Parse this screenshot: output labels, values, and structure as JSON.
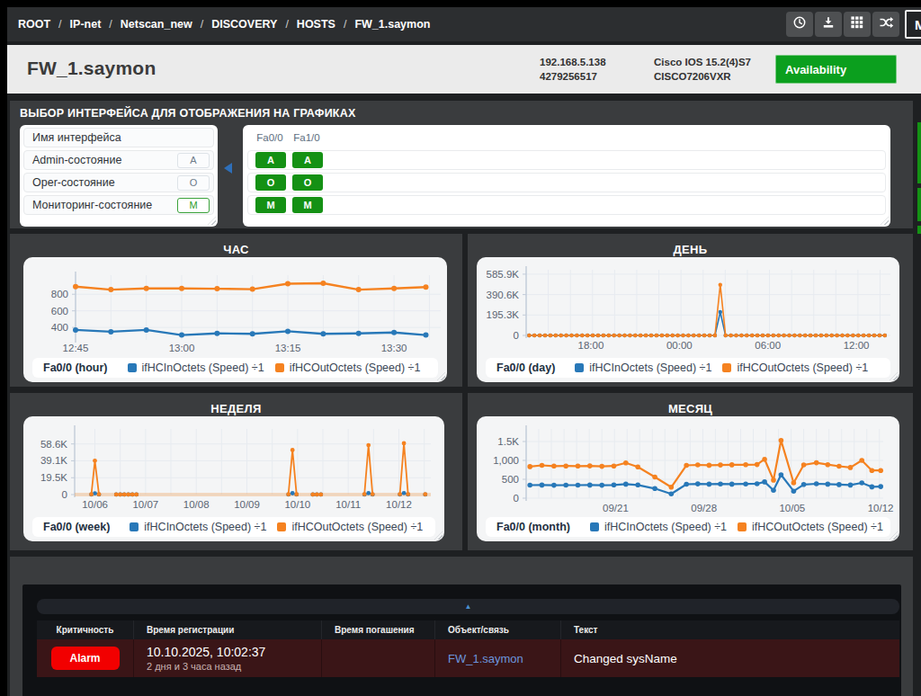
{
  "nav": {
    "breadcrumbs": [
      "ROOT",
      "IP-net",
      "Netscan_new",
      "DISCOVERY",
      "HOSTS",
      "FW_1.saymon"
    ],
    "separator": "/",
    "buttons": [
      {
        "icon": "clock-icon",
        "name": "history-button"
      },
      {
        "icon": "download-icon",
        "name": "download-button"
      },
      {
        "icon": "grid-icon",
        "name": "apps-button"
      },
      {
        "icon": "shuffle-icon",
        "name": "shuffle-button"
      }
    ],
    "partial_button_label": "M"
  },
  "header": {
    "title": "FW_1.saymon",
    "ip": "192.168.5.138",
    "serial": "4279256517",
    "os": "Cisco IOS 15.2(4)S7",
    "model": "CISCO7206VXR",
    "availability_label": "Availability",
    "availability_color": "#0b9f1e"
  },
  "interface_section": {
    "title": "ВЫБОР ИНТЕРФЕЙСА ДЛЯ ОТОБРАЖЕНИЯ НА ГРАФИКАХ",
    "legend_rows": [
      {
        "label": "Имя интерфейса",
        "badge": "",
        "badge_style": "none"
      },
      {
        "label": "Admin-состояние",
        "badge": "A",
        "badge_style": "gray"
      },
      {
        "label": "Oper-состояние",
        "badge": "O",
        "badge_style": "gray"
      },
      {
        "label": "Мониторинг-состояние",
        "badge": "M",
        "badge_style": "green-outline"
      }
    ],
    "interfaces": [
      "Fa0/0",
      "Fa1/0"
    ],
    "state_rows": [
      [
        "A",
        "A"
      ],
      [
        "O",
        "O"
      ],
      [
        "M",
        "M"
      ]
    ],
    "state_color": "#149114"
  },
  "alarm_panel": {
    "collapse_icon": "▲",
    "columns": [
      "Критичность",
      "Время регистрации",
      "Время погашения",
      "Объект/связь",
      "Текст"
    ],
    "rows": [
      {
        "severity": "Alarm",
        "severity_color": "#f20000",
        "registered": "10.10.2025, 10:02:37",
        "registered_ago": "2 дня и 3 часа назад",
        "cleared": "",
        "object": "FW_1.saymon",
        "text": "Changed sysName"
      }
    ]
  },
  "chart_data": [
    {
      "type": "line",
      "title": "ЧАС",
      "legend_label": "Fa0/0 (hour)",
      "xlim": [
        0,
        51.6
      ],
      "ylim": [
        250,
        1030
      ],
      "xticks": [
        {
          "x": 0,
          "label": "12:45"
        },
        {
          "x": 15,
          "label": "13:00"
        },
        {
          "x": 30,
          "label": "13:15"
        },
        {
          "x": 45,
          "label": "13:30"
        }
      ],
      "yticks": [
        {
          "v": 400,
          "label": "400"
        },
        {
          "v": 600,
          "label": "600"
        },
        {
          "v": 800,
          "label": "800"
        }
      ],
      "grid_x_step": 5,
      "marker_r": 3.0,
      "line_w": 2.4,
      "zero_band": false,
      "series": [
        {
          "name": "ifHCInOctets (Speed) ÷1",
          "color": "#2878b8",
          "x": [
            0,
            5,
            10,
            15,
            20,
            25,
            30,
            35,
            40,
            45,
            49.5
          ],
          "values": [
            370,
            349,
            370,
            309,
            329,
            324,
            354,
            324,
            329,
            339,
            309
          ]
        },
        {
          "name": "ifHCOutOctets (Speed) ÷1",
          "color": "#f58220",
          "x": [
            0,
            5,
            10,
            15,
            20,
            25,
            30,
            35,
            40,
            45,
            49.5
          ],
          "values": [
            891,
            856,
            871,
            871,
            866,
            861,
            927,
            932,
            856,
            871,
            886
          ]
        }
      ]
    },
    {
      "type": "line",
      "title": "ДЕНЬ",
      "legend_label": "Fa0/0 (day)",
      "xlim": [
        0,
        24.7
      ],
      "ylim": [
        0,
        628000
      ],
      "xticks": [
        {
          "x": 4.39,
          "label": "18:00"
        },
        {
          "x": 10.39,
          "label": "00:00"
        },
        {
          "x": 16.39,
          "label": "06:00"
        },
        {
          "x": 22.39,
          "label": "12:00"
        }
      ],
      "yticks": [
        {
          "v": 0,
          "label": "0"
        },
        {
          "v": 195300,
          "label": "195.3K"
        },
        {
          "v": 390600,
          "label": "390.6K"
        },
        {
          "v": 585900,
          "label": "585.9K"
        }
      ],
      "grid_x_step": 1.5,
      "marker_r": 2.2,
      "line_w": 1.6,
      "zero_band": false,
      "series": [
        {
          "name": "ifHCInOctets (Speed) ÷1",
          "color": "#2878b8",
          "x": [
            0.2,
            0.56,
            0.92,
            1.28,
            1.64,
            2.0,
            2.36,
            2.72,
            3.08,
            3.44,
            3.8,
            4.16,
            4.52,
            4.88,
            5.24,
            5.6,
            5.96,
            6.32,
            6.68,
            7.04,
            7.4,
            7.76,
            8.12,
            8.48,
            8.84,
            9.2,
            9.56,
            9.92,
            10.28,
            10.64,
            11.0,
            11.36,
            11.72,
            12.08,
            12.44,
            12.8,
            13.16,
            13.52,
            13.88,
            14.24,
            14.6,
            14.96,
            15.32,
            15.68,
            16.04,
            16.4,
            16.76,
            17.12,
            17.48,
            17.84,
            18.2,
            18.56,
            18.92,
            19.28,
            19.64,
            20.0,
            20.36,
            20.72,
            21.08,
            21.44,
            21.8,
            22.16,
            22.52,
            22.88,
            23.24,
            23.6,
            23.96,
            24.32
          ],
          "values": [
            0,
            0,
            0,
            0,
            0,
            0,
            0,
            0,
            0,
            0,
            0,
            0,
            0,
            0,
            0,
            0,
            0,
            0,
            0,
            0,
            0,
            0,
            0,
            0,
            0,
            0,
            0,
            0,
            0,
            0,
            0,
            0,
            0,
            0,
            0,
            0,
            224000,
            0,
            0,
            0,
            0,
            0,
            0,
            0,
            0,
            0,
            0,
            0,
            0,
            0,
            0,
            0,
            0,
            0,
            0,
            0,
            0,
            0,
            0,
            0,
            0,
            0,
            0,
            0,
            0,
            0,
            0,
            0
          ]
        },
        {
          "name": "ifHCOutOctets (Speed) ÷1",
          "color": "#f58220",
          "x": [
            0.2,
            0.56,
            0.92,
            1.28,
            1.64,
            2.0,
            2.36,
            2.72,
            3.08,
            3.44,
            3.8,
            4.16,
            4.52,
            4.88,
            5.24,
            5.6,
            5.96,
            6.32,
            6.68,
            7.04,
            7.4,
            7.76,
            8.12,
            8.48,
            8.84,
            9.2,
            9.56,
            9.92,
            10.28,
            10.64,
            11.0,
            11.36,
            11.72,
            12.08,
            12.44,
            12.8,
            13.16,
            13.52,
            13.88,
            14.24,
            14.6,
            14.96,
            15.32,
            15.68,
            16.04,
            16.4,
            16.76,
            17.12,
            17.48,
            17.84,
            18.2,
            18.56,
            18.92,
            19.28,
            19.64,
            20.0,
            20.36,
            20.72,
            21.08,
            21.44,
            21.8,
            22.16,
            22.52,
            22.88,
            23.24,
            23.6,
            23.96,
            24.32
          ],
          "values": [
            0,
            0,
            0,
            0,
            0,
            0,
            0,
            0,
            0,
            0,
            0,
            0,
            0,
            0,
            0,
            0,
            0,
            0,
            0,
            0,
            0,
            0,
            0,
            0,
            0,
            0,
            0,
            0,
            0,
            0,
            0,
            0,
            0,
            0,
            0,
            0,
            484000,
            0,
            0,
            0,
            0,
            0,
            0,
            0,
            0,
            0,
            0,
            0,
            0,
            0,
            0,
            0,
            0,
            0,
            0,
            0,
            0,
            0,
            0,
            0,
            0,
            0,
            0,
            0,
            0,
            0,
            0,
            0
          ]
        }
      ]
    },
    {
      "type": "line",
      "title": "НЕДЕЛЯ",
      "legend_label": "Fa0/0 (week)",
      "xlim": [
        -0.4,
        6.63
      ],
      "ylim": [
        0,
        76000
      ],
      "xticks": [
        {
          "x": 0,
          "label": "10/06"
        },
        {
          "x": 1,
          "label": "10/07"
        },
        {
          "x": 2,
          "label": "10/08"
        },
        {
          "x": 3,
          "label": "10/09"
        },
        {
          "x": 4,
          "label": "10/10"
        },
        {
          "x": 5,
          "label": "10/11"
        },
        {
          "x": 6,
          "label": "10/12"
        }
      ],
      "yticks": [
        {
          "v": 0,
          "label": "0"
        },
        {
          "v": 19500,
          "label": "19.5K"
        },
        {
          "v": 39100,
          "label": "39.1K"
        },
        {
          "v": 58600,
          "label": "58.6K"
        }
      ],
      "grid_x_step": 0.5,
      "marker_r": 2.4,
      "line_w": 1.8,
      "zero_band": true,
      "series": [
        {
          "name": "ifHCInOctets (Speed) ÷1",
          "color": "#2878b8",
          "x": [
            -0.07,
            0,
            0.08,
            null,
            0.42,
            0.5,
            0.58,
            0.66,
            0.74,
            0.82,
            null,
            3.82,
            3.9,
            3.98,
            null,
            4.3,
            4.38,
            4.46,
            null,
            5.32,
            5.4,
            5.48,
            null,
            6.02,
            6.1,
            6.18,
            null,
            6.52
          ],
          "values": [
            100,
            1500,
            100,
            null,
            80,
            80,
            80,
            80,
            80,
            80,
            null,
            100,
            1600,
            100,
            null,
            80,
            80,
            80,
            null,
            120,
            1700,
            120,
            null,
            120,
            1800,
            120,
            null,
            100
          ]
        },
        {
          "name": "ifHCOutOctets (Speed) ÷1",
          "color": "#f58220",
          "x": [
            -0.07,
            0,
            0.08,
            null,
            0.42,
            0.5,
            0.58,
            0.66,
            0.74,
            0.82,
            null,
            3.82,
            3.9,
            3.98,
            null,
            4.3,
            4.38,
            4.46,
            null,
            5.32,
            5.4,
            5.48,
            null,
            6.02,
            6.1,
            6.18,
            null,
            6.52
          ],
          "values": [
            300,
            39300,
            300,
            null,
            150,
            150,
            150,
            150,
            150,
            150,
            null,
            300,
            51500,
            300,
            null,
            150,
            150,
            150,
            null,
            400,
            57200,
            400,
            null,
            400,
            59300,
            400,
            null,
            300
          ]
        }
      ]
    },
    {
      "type": "line",
      "title": "МЕСЯЦ",
      "legend_label": "Fa0/0 (month)",
      "xlim": [
        0,
        28.3
      ],
      "ylim": [
        0,
        1833
      ],
      "xticks": [
        {
          "x": 7.09,
          "label": "09/21"
        },
        {
          "x": 14.09,
          "label": "09/28"
        },
        {
          "x": 21.09,
          "label": "10/05"
        },
        {
          "x": 28.09,
          "label": "10/12"
        }
      ],
      "yticks": [
        {
          "v": 0,
          "label": "0"
        },
        {
          "v": 500,
          "label": "500"
        },
        {
          "v": 1000,
          "label": "1,000"
        },
        {
          "v": 1500,
          "label": "1.5K"
        }
      ],
      "grid_x_step": 1,
      "marker_r": 2.8,
      "line_w": 2.2,
      "zero_band": false,
      "series": [
        {
          "name": "ifHCInOctets (Speed) ÷1",
          "color": "#2878b8",
          "x": [
            0.3,
            1.25,
            2.2,
            3.15,
            4.1,
            5.05,
            6.0,
            6.95,
            7.9,
            8.85,
            10.2,
            11.5,
            12.7,
            13.6,
            14.5,
            15.4,
            16.3,
            17.4,
            18.3,
            18.9,
            19.6,
            20.2,
            21.2,
            22.0,
            23.0,
            23.9,
            24.8,
            25.7,
            26.6,
            27.4,
            28.1
          ],
          "values": [
            345,
            348,
            343,
            346,
            344,
            347,
            343,
            350,
            372,
            350,
            255,
            115,
            368,
            378,
            372,
            375,
            372,
            376,
            380,
            432,
            210,
            620,
            185,
            362,
            380,
            372,
            360,
            348,
            405,
            300,
            308
          ]
        },
        {
          "name": "ifHCOutOctets (Speed) ÷1",
          "color": "#f58220",
          "x": [
            0.3,
            1.25,
            2.2,
            3.15,
            4.1,
            5.05,
            6.0,
            6.95,
            7.9,
            8.85,
            10.2,
            11.5,
            12.7,
            13.6,
            14.5,
            15.4,
            16.3,
            17.4,
            18.3,
            18.9,
            19.6,
            20.2,
            21.2,
            22.0,
            23.0,
            23.9,
            24.8,
            25.7,
            26.6,
            27.4,
            28.1
          ],
          "values": [
            835,
            868,
            850,
            852,
            850,
            855,
            842,
            852,
            935,
            828,
            560,
            290,
            870,
            880,
            872,
            878,
            882,
            885,
            890,
            1030,
            478,
            1530,
            405,
            880,
            938,
            888,
            845,
            812,
            1000,
            733,
            733
          ]
        }
      ]
    }
  ]
}
